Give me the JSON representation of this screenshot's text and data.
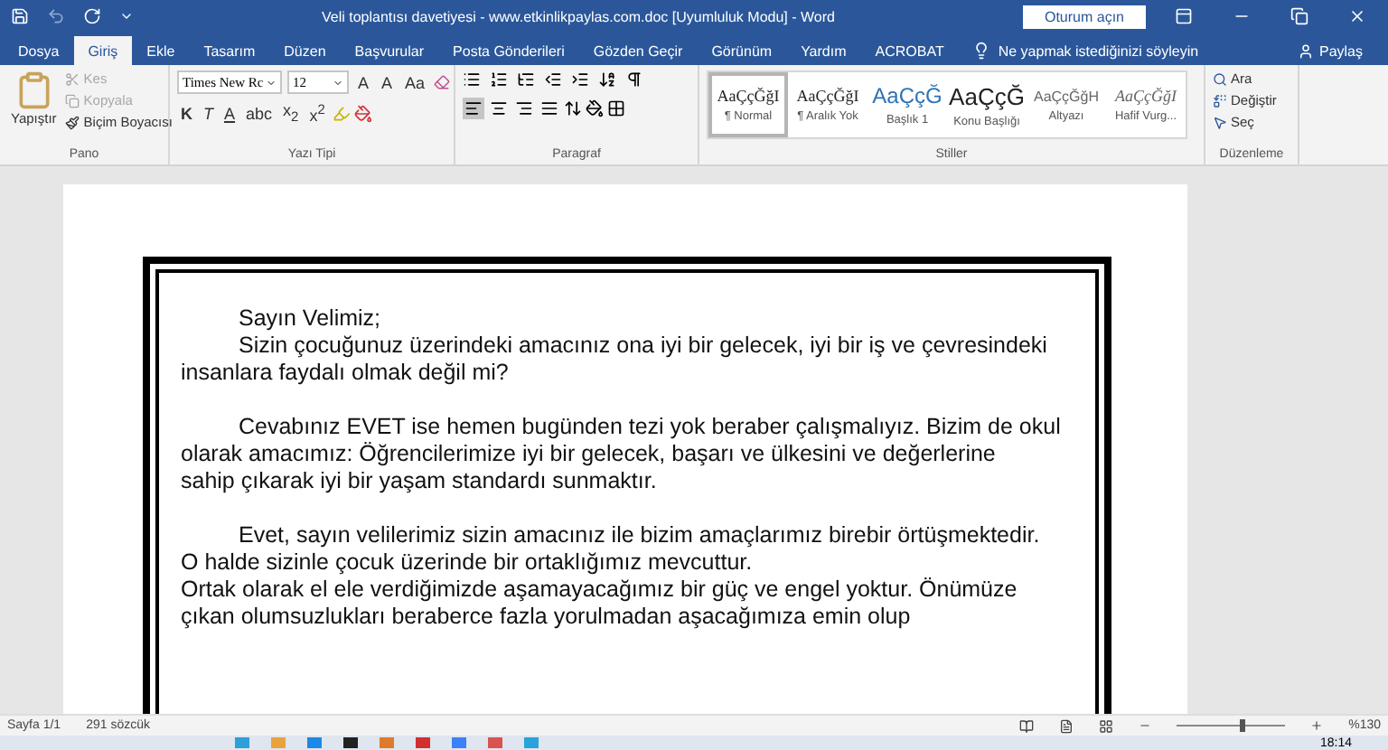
{
  "window": {
    "title": "Veli toplantısı davetiyesi - www.etkinlikpaylas.com.doc [Uyumluluk Modu]  -  Word",
    "sign_in": "Oturum açın"
  },
  "tabs": [
    {
      "label": "Dosya",
      "selected": false
    },
    {
      "label": "Giriş",
      "selected": true
    },
    {
      "label": "Ekle",
      "selected": false
    },
    {
      "label": "Tasarım",
      "selected": false
    },
    {
      "label": "Düzen",
      "selected": false
    },
    {
      "label": "Başvurular",
      "selected": false
    },
    {
      "label": "Posta Gönderileri",
      "selected": false
    },
    {
      "label": "Gözden Geçir",
      "selected": false
    },
    {
      "label": "Görünüm",
      "selected": false
    },
    {
      "label": "Yardım",
      "selected": false
    },
    {
      "label": "ACROBAT",
      "selected": false
    }
  ],
  "tell_me": {
    "placeholder": "Ne yapmak istediğinizi söyleyin"
  },
  "share": "Paylaş",
  "ribbon": {
    "clipboard": {
      "label": "Pano",
      "paste": "Yapıştır",
      "items": [
        {
          "label": "Kes",
          "disabled": true
        },
        {
          "label": "Kopyala",
          "disabled": true
        },
        {
          "label": "Biçim Boyacısı",
          "disabled": false
        }
      ]
    },
    "font": {
      "label": "Yazı Tipi",
      "font_name": "Times New Rc",
      "font_size": "12",
      "size_buttons": [
        "A",
        "A",
        "Aa"
      ],
      "format_buttons": [
        "K",
        "T",
        "A",
        "abc",
        "x$_{2}$",
        "x$^{2}$"
      ]
    },
    "paragraph": {
      "label": "Paragraf",
      "alignments": [
        {
          "selected": true
        },
        {
          "selected": false
        },
        {
          "selected": false
        },
        {
          "selected": false
        }
      ]
    },
    "styles": {
      "label": "Stiller",
      "items": [
        {
          "kind": "normal",
          "preview": "AaÇçĞğI",
          "name": "¶ Normal",
          "selected": true
        },
        {
          "kind": "normal",
          "preview": "AaÇçĞğI",
          "name": "¶ Aralık Yok",
          "selected": false
        },
        {
          "kind": "heading",
          "preview": "AaÇçĞ",
          "name": "Başlık 1",
          "selected": false
        },
        {
          "kind": "title",
          "preview": "AaÇçĞ",
          "name": "Konu Başlığı",
          "selected": false
        },
        {
          "kind": "subtitle",
          "preview": "AaÇçĞğH",
          "name": "Altyazı",
          "selected": false
        },
        {
          "kind": "emphasis",
          "preview": "AaÇçĞğI",
          "name": "Hafif Vurg...",
          "selected": false
        }
      ]
    },
    "editing": {
      "label": "Düzenleme",
      "items": [
        "Ara",
        "Değiştir",
        "Seç"
      ]
    }
  },
  "document": {
    "blocks": [
      [
        {
          "indented": true,
          "lines": [
            "Sayın Velimiz;"
          ]
        },
        {
          "indented": true,
          "lines": [
            "Sizin çocuğunuz üzerindeki amacınız ona iyi bir gelecek, iyi bir iş ve çevresindeki",
            "insanlara faydalı olmak değil mi?"
          ]
        }
      ],
      [
        {
          "indented": true,
          "lines": [
            "Cevabınız EVET ise hemen bugünden tezi yok beraber çalışmalıyız. Bizim de okul",
            "olarak amacımız: Öğrencilerimize iyi bir gelecek, başarı ve ülkesini ve değerlerine",
            "sahip çıkarak iyi bir yaşam standardı sunmaktır."
          ]
        }
      ],
      [
        {
          "indented": true,
          "lines": [
            "Evet, sayın velilerimiz sizin amacınız ile bizim amaçlarımız birebir örtüşmektedir.",
            "O halde sizinle çocuk üzerinde bir ortaklığımız mevcuttur."
          ]
        },
        {
          "indented": false,
          "lines": [
            "Ortak olarak el ele verdiğimizde aşamayacağımız bir güç ve engel yoktur. Önümüze",
            "çıkan olumsuzlukları beraberce fazla yorulmadan aşacağımıza emin olup"
          ]
        }
      ]
    ]
  },
  "status_bar": {
    "page": "Sayfa 1/1",
    "words": "291 sözcük",
    "zoom_slider": {
      "level": 0.6
    },
    "zoom": "%130"
  },
  "taskbar": {
    "time": "18:14"
  }
}
